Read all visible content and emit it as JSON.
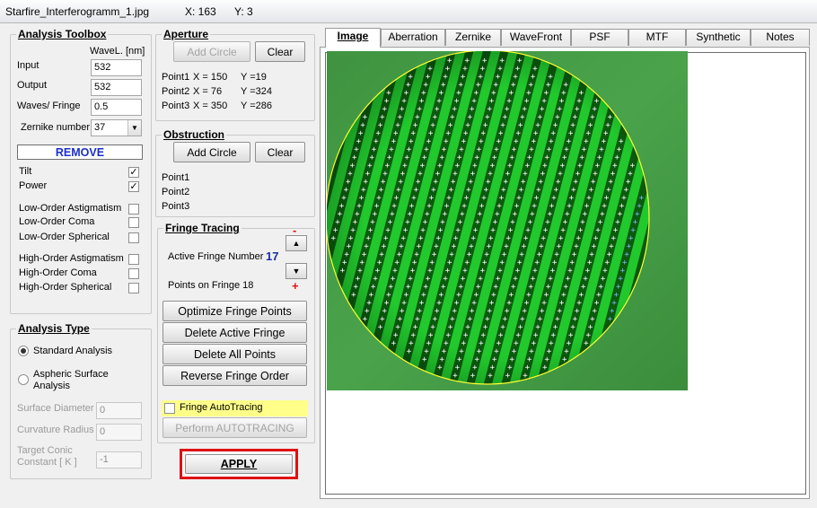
{
  "window": {
    "title": "Starfire_Interferogramm_1.jpg",
    "coord_x": "X: 163",
    "coord_y": "Y: 3"
  },
  "toolbox": {
    "title": "Analysis Toolbox",
    "wavelength_header": "WaveL. [nm]",
    "input_label": "Input",
    "input_value": "532",
    "output_label": "Output",
    "output_value": "532",
    "waves_label": "Waves/ Fringe",
    "waves_value": "0.5",
    "zernike_label": "Zernike number",
    "zernike_value": "37",
    "remove_label": "REMOVE",
    "terms": [
      {
        "label": "Tilt",
        "checked": true
      },
      {
        "label": "Power",
        "checked": true
      },
      {
        "label": "Low-Order  Astigmatism",
        "checked": false
      },
      {
        "label": "Low-Order  Coma",
        "checked": false
      },
      {
        "label": "Low-Order  Spherical",
        "checked": false
      },
      {
        "label": "High-Order  Astigmatism",
        "checked": false
      },
      {
        "label": "High-Order  Coma",
        "checked": false
      },
      {
        "label": "High-Order  Spherical",
        "checked": false
      }
    ]
  },
  "analysis_type": {
    "title": "Analysis Type",
    "standard_label": "Standard  Analysis",
    "aspheric_label_1": "Aspheric  Surface",
    "aspheric_label_2": "Analysis",
    "surface_diameter_label": "Surface Diameter",
    "surface_diameter_value": "0",
    "curvature_radius_label": "Curvature Radius",
    "curvature_radius_value": "0",
    "target_conic_label_1": "Target Conic",
    "target_conic_label_2": "Constant [ K ]",
    "target_conic_value": "-1"
  },
  "aperture": {
    "title": "Aperture",
    "add_circle_label": "Add Circle",
    "clear_label": "Clear",
    "points": [
      {
        "name": "Point1",
        "x": "X =   150",
        "y": "Y =19"
      },
      {
        "name": "Point2",
        "x": "X =   76",
        "y": "Y =324"
      },
      {
        "name": "Point3",
        "x": "X =   350",
        "y": "Y =286"
      }
    ]
  },
  "obstruction": {
    "title": "Obstruction",
    "add_circle_label": "Add Circle",
    "clear_label": "Clear",
    "points": [
      "Point1",
      "Point2",
      "Point3"
    ]
  },
  "fringe_tracing": {
    "title": "Fringe Tracing",
    "active_label": "Active Fringe Number",
    "active_value": "17",
    "minus_sign": "-",
    "plus_sign": "+",
    "points_on_label": "Points on  Fringe 18",
    "optimize_label": "Optimize Fringe Points",
    "delete_active_label": "Delete Active Fringe",
    "delete_all_label": "Delete  All  Points",
    "reverse_label": "Reverse  Fringe Order",
    "autotracing_label": "Fringe AutoTracing",
    "perform_label": "Perform  AUTOTRACING"
  },
  "apply_label": "APPLY",
  "tabs": [
    "Image",
    "Aberration",
    "Zernike",
    "WaveFront",
    "PSF",
    "MTF",
    "Synthetic",
    "Notes"
  ],
  "colors": {
    "fringe_bright": "#21c92d",
    "fringe_dark": "#0b5a0e",
    "aperture_circle": "#ffff30",
    "remove_text": "#1a2fc8",
    "apply_border": "#e01010",
    "active_fringe_number": "#1a2fa0",
    "minus_plus": "#e01010"
  }
}
